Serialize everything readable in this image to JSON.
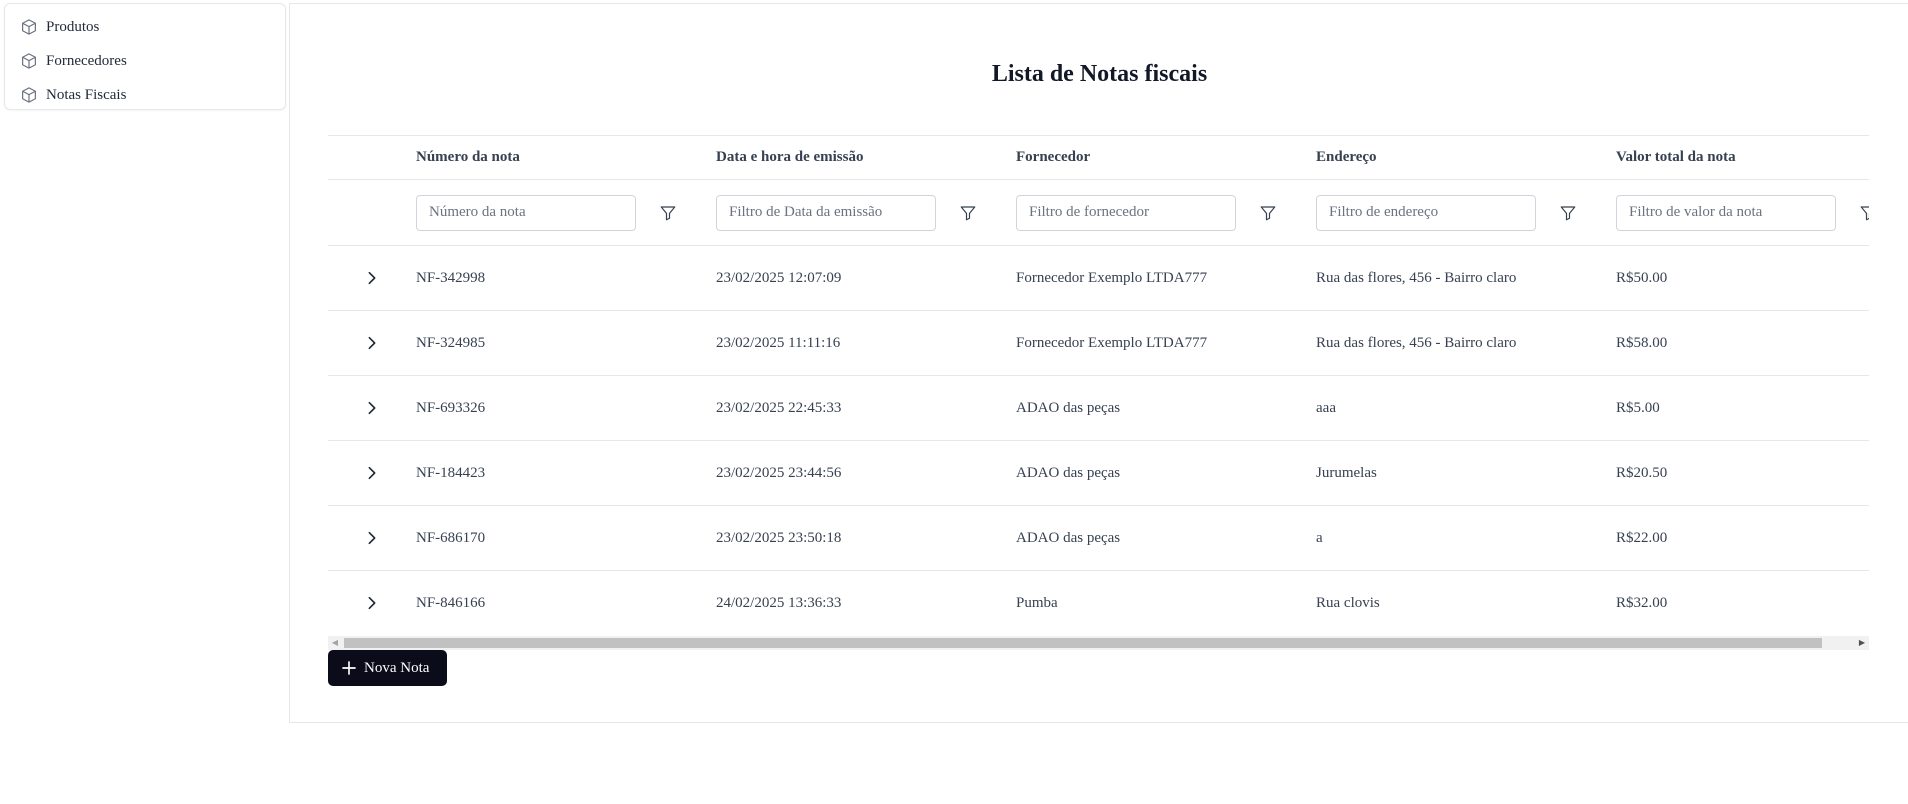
{
  "sidebar": {
    "items": [
      {
        "label": "Produtos",
        "icon": "box-icon"
      },
      {
        "label": "Fornecedores",
        "icon": "box-icon"
      },
      {
        "label": "Notas Fiscais",
        "icon": "box-icon"
      }
    ]
  },
  "page": {
    "title": "Lista de Notas fiscais"
  },
  "table": {
    "headers": [
      "Número da nota",
      "Data e hora de emissão",
      "Fornecedor",
      "Endereço",
      "Valor total da nota"
    ],
    "filters": [
      {
        "placeholder": "Número da nota"
      },
      {
        "placeholder": "Filtro de Data da emissão"
      },
      {
        "placeholder": "Filtro de fornecedor"
      },
      {
        "placeholder": "Filtro de endereço"
      },
      {
        "placeholder": "Filtro de valor da nota"
      }
    ],
    "rows": [
      {
        "numero": "NF-342998",
        "data": "23/02/2025 12:07:09",
        "fornecedor": "Fornecedor Exemplo LTDA777",
        "endereco": "Rua das flores, 456 - Bairro claro",
        "valor": "R$50.00"
      },
      {
        "numero": "NF-324985",
        "data": "23/02/2025 11:11:16",
        "fornecedor": "Fornecedor Exemplo LTDA777",
        "endereco": "Rua das flores, 456 - Bairro claro",
        "valor": "R$58.00"
      },
      {
        "numero": "NF-693326",
        "data": "23/02/2025 22:45:33",
        "fornecedor": "ADAO das peças",
        "endereco": "aaa",
        "valor": "R$5.00"
      },
      {
        "numero": "NF-184423",
        "data": "23/02/2025 23:44:56",
        "fornecedor": "ADAO das peças",
        "endereco": "Jurumelas",
        "valor": "R$20.50"
      },
      {
        "numero": "NF-686170",
        "data": "23/02/2025 23:50:18",
        "fornecedor": "ADAO das peças",
        "endereco": "a",
        "valor": "R$22.00"
      },
      {
        "numero": "NF-846166",
        "data": "24/02/2025 13:36:33",
        "fornecedor": "Pumba",
        "endereco": "Rua clovis",
        "valor": "R$32.00"
      }
    ]
  },
  "actions": {
    "new_label": "Nova Nota"
  },
  "colors": {
    "accent": "#0b0c1a",
    "border": "#e5e7eb",
    "text": "#374151"
  }
}
